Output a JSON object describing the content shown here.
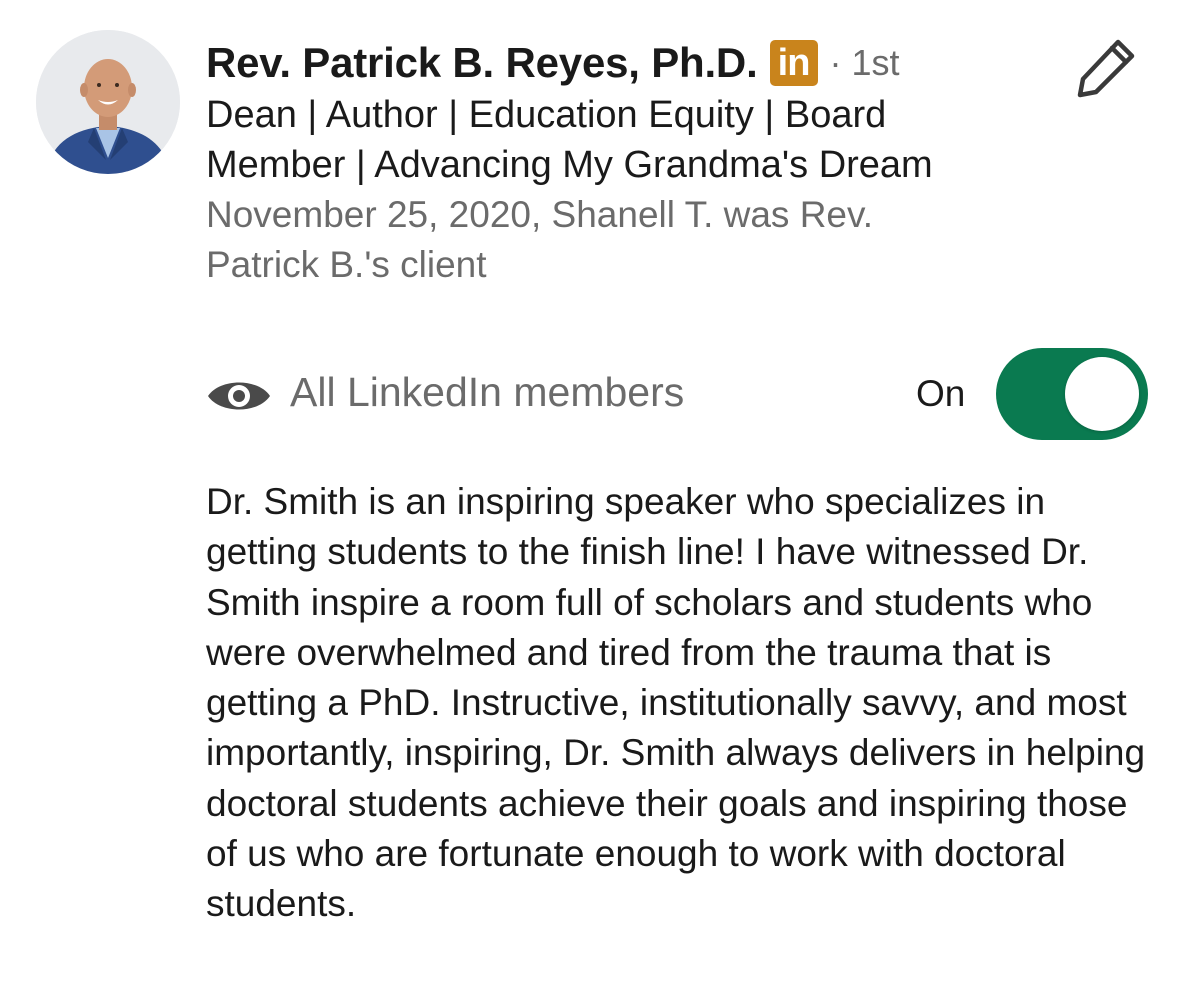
{
  "profile": {
    "name": "Rev. Patrick B. Reyes, Ph.D.",
    "badge_text": "in",
    "degree": "· 1st",
    "headline": "Dean | Author | Education Equity | Board Member | Advancing My Grandma's Dream",
    "meta": "November 25, 2020, Shanell T. was Rev. Patrick B.'s client"
  },
  "visibility": {
    "label": "All LinkedIn members",
    "toggle_label": "On",
    "toggle_on": true
  },
  "recommendation": {
    "text": "Dr. Smith is an inspiring speaker who specializes in getting students to the finish line! I have witnessed Dr. Smith inspire a room full of scholars and students who were overwhelmed and tired from the trauma that is getting a PhD. Instructive, institutionally savvy, and most importantly, inspiring, Dr. Smith always delivers in helping doctoral students achieve their goals and inspiring those of us who are fortunate enough to work with doctoral students."
  },
  "icons": {
    "edit": "pencil-icon",
    "visibility": "eye-icon",
    "network": "linkedin-icon"
  },
  "colors": {
    "toggle_on": "#0a7a50",
    "badge": "#c9841c",
    "secondary_text": "#6b6b6b"
  }
}
